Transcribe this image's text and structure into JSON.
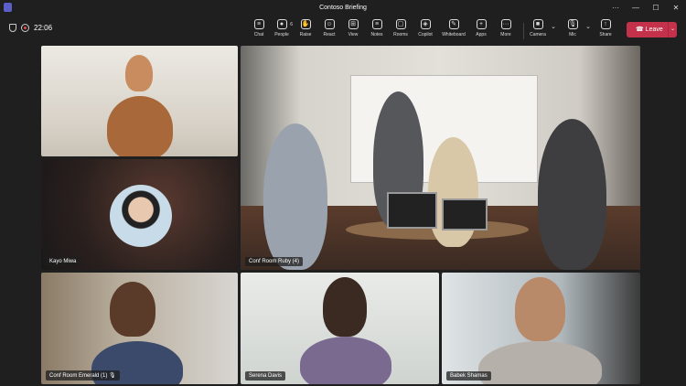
{
  "window": {
    "title": "Contoso Briefing",
    "controls": [
      "···",
      "—",
      "☐",
      "✕"
    ]
  },
  "status": {
    "time": "22:06"
  },
  "toolbar": [
    {
      "label": "Chat",
      "icon": "chat-icon",
      "glyph": "≡"
    },
    {
      "label": "People",
      "icon": "people-icon",
      "glyph": "●",
      "badge": "6"
    },
    {
      "label": "Raise",
      "icon": "hand-icon",
      "glyph": "✋"
    },
    {
      "label": "React",
      "icon": "smile-icon",
      "glyph": "☺"
    },
    {
      "label": "View",
      "icon": "grid-icon",
      "glyph": "⊞"
    },
    {
      "label": "Notes",
      "icon": "notes-icon",
      "glyph": "≡"
    },
    {
      "label": "Rooms",
      "icon": "rooms-icon",
      "glyph": "▢"
    },
    {
      "label": "Copilot",
      "icon": "copilot-icon",
      "glyph": "◈"
    },
    {
      "label": "Whiteboard",
      "icon": "whiteboard-icon",
      "glyph": "✎"
    },
    {
      "label": "Apps",
      "icon": "apps-icon",
      "glyph": "+"
    },
    {
      "label": "More",
      "icon": "more-icon",
      "glyph": "···"
    },
    {
      "label": "Camera",
      "icon": "camera-icon",
      "glyph": "■"
    },
    {
      "label": "Mic",
      "icon": "mic-icon",
      "glyph": "🎙"
    },
    {
      "label": "Share",
      "icon": "share-icon",
      "glyph": "↑"
    }
  ],
  "leave_label": "Leave",
  "participants": {
    "kayo": "Kayo Miwa",
    "ruby": "Conf Room Ruby (4)",
    "emerald": "Conf Room Emerald (1)",
    "serena": "Serena Davis",
    "babek": "Babek Shamas"
  },
  "colors": {
    "leave": "#c4314b",
    "accent": "#5b5fc7"
  }
}
